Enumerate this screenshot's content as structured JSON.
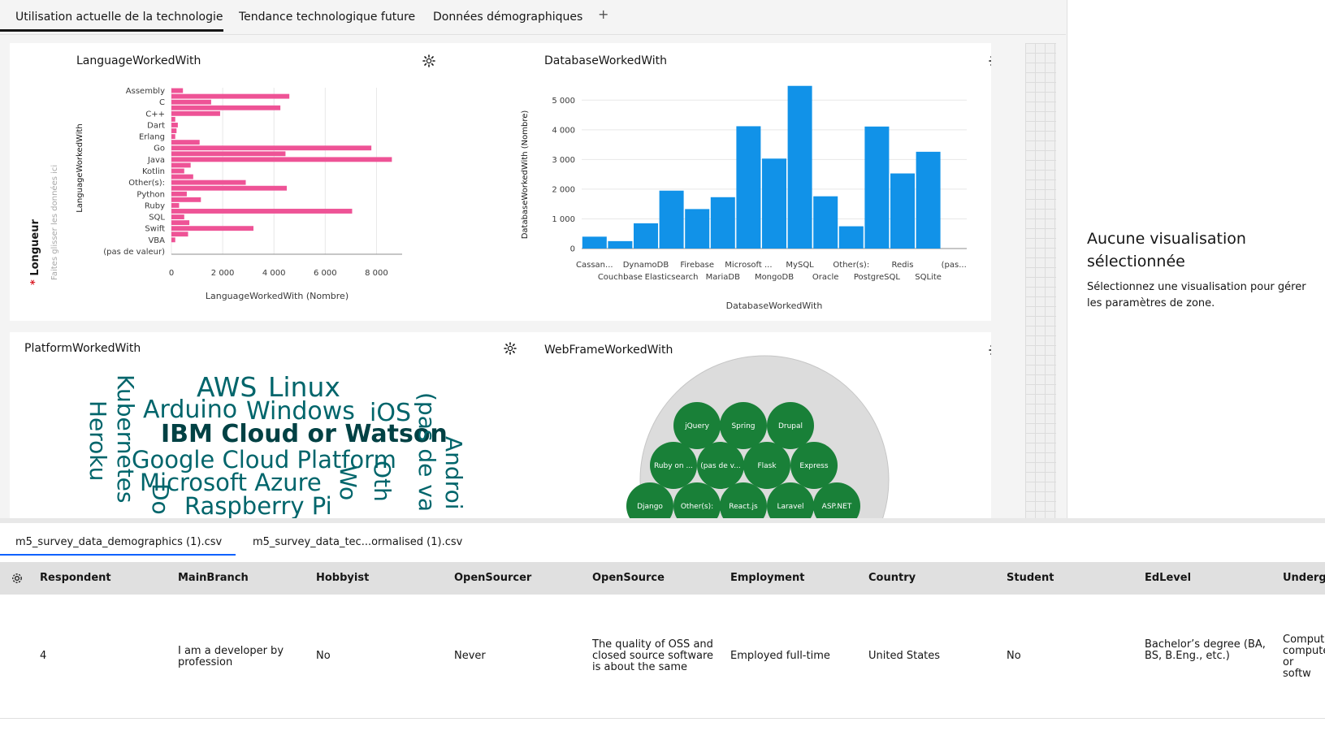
{
  "top_tabs": [
    "Utilisation actuelle de la technologie",
    "Tendance technologique future",
    "Données démographiques"
  ],
  "add_tab": "+",
  "lang_chart": {
    "title": "LanguageWorkedWith",
    "xlabel": "LanguageWorkedWith (Nombre)",
    "ylabel": "LanguageWorkedWith",
    "drop_label": "Longueur",
    "drop_hint": "Faites glisser les données ici",
    "required_mark": "*",
    "bar_color": "#ee5396"
  },
  "db_chart": {
    "title": "DatabaseWorkedWith",
    "xlabel": "DatabaseWorkedWith",
    "ylabel": "DatabaseWorkedWith (Nombre)",
    "bar_color": "#1192e8"
  },
  "platform_chart": {
    "title": "PlatformWorkedWith",
    "word_color": "#00656b",
    "words": [
      "AWS",
      "Linux",
      "Arduino",
      "Windows",
      "iOS",
      "IBM Cloud or Watson",
      "Google Cloud Platform",
      "Microsoft Azure",
      "Raspberry Pi",
      "Kubernetes",
      "Heroku",
      "Do",
      "Wo",
      "Oth",
      "(pas de va",
      "Androi"
    ]
  },
  "webframe_chart": {
    "title": "WebFrameWorkedWith",
    "bubble_color": "#198038",
    "bubbles": [
      "jQuery",
      "Spring",
      "Drupal",
      "Ruby on ...",
      "(pas de v...",
      "Flask",
      "Express",
      "Django",
      "Other(s):",
      "React.js",
      "Laravel",
      "ASP.NET"
    ]
  },
  "right_panel": {
    "title": "Aucune visualisation sélectionnée",
    "description": "Sélectionnez une visualisation pour gérer les paramètres de zone."
  },
  "file_tabs": [
    "m5_survey_data_demographics (1).csv",
    "m5_survey_data_tec...ormalised (1).csv"
  ],
  "table": {
    "columns": [
      "Respondent",
      "MainBranch",
      "Hobbyist",
      "OpenSourcer",
      "OpenSource",
      "Employment",
      "Country",
      "Student",
      "EdLevel",
      "Underg"
    ],
    "row": [
      "4",
      "I am a developer by profession",
      "No",
      "Never",
      "The quality of OSS and closed source software is about the same",
      "Employed full-time",
      "United States",
      "No",
      "Bachelor’s degree (BA, BS, B.Eng., etc.)",
      "Comput computer or softw"
    ]
  },
  "chart_data": [
    {
      "type": "bar",
      "orientation": "horizontal",
      "title": "LanguageWorkedWith",
      "xlabel": "LanguageWorkedWith (Nombre)",
      "ylabel": "LanguageWorkedWith",
      "xlim": [
        0,
        9000
      ],
      "xticks": [
        "0",
        "2 000",
        "4 000",
        "6 000",
        "8 000"
      ],
      "labels": [
        "Assembly",
        "",
        "C",
        "",
        "C++",
        "",
        "Dart",
        "",
        "Erlang",
        "",
        "Go",
        "",
        "Java",
        "",
        "Kotlin",
        "",
        "Other(s):",
        "",
        "Python",
        "",
        "Ruby",
        "",
        "SQL",
        "",
        "Swift",
        "",
        "VBA",
        "",
        "(pas de valeur)"
      ],
      "values": [
        450,
        4600,
        1550,
        4250,
        1900,
        150,
        250,
        200,
        150,
        1100,
        7800,
        4450,
        8600,
        750,
        500,
        850,
        2900,
        4500,
        600,
        1150,
        300,
        7050,
        500,
        700,
        3200,
        650,
        150,
        0,
        0
      ]
    },
    {
      "type": "bar",
      "title": "DatabaseWorkedWith",
      "xlabel": "DatabaseWorkedWith",
      "ylabel": "DatabaseWorkedWith (Nombre)",
      "ylim": [
        0,
        5500
      ],
      "yticks": [
        "0",
        "1 000",
        "2 000",
        "3 000",
        "4 000",
        "5 000"
      ],
      "categories": [
        "Cassan...",
        "Couchbase",
        "DynamoDB",
        "Elasticsearch",
        "Firebase",
        "MariaDB",
        "Microsoft ...",
        "MongoDB",
        "MySQL",
        "Oracle",
        "Other(s):",
        "PostgreSQL",
        "Redis",
        "SQLite",
        "(pas..."
      ],
      "values": [
        400,
        250,
        850,
        1950,
        1330,
        1730,
        4120,
        3030,
        5480,
        1760,
        750,
        4110,
        2530,
        3260,
        0
      ]
    }
  ]
}
